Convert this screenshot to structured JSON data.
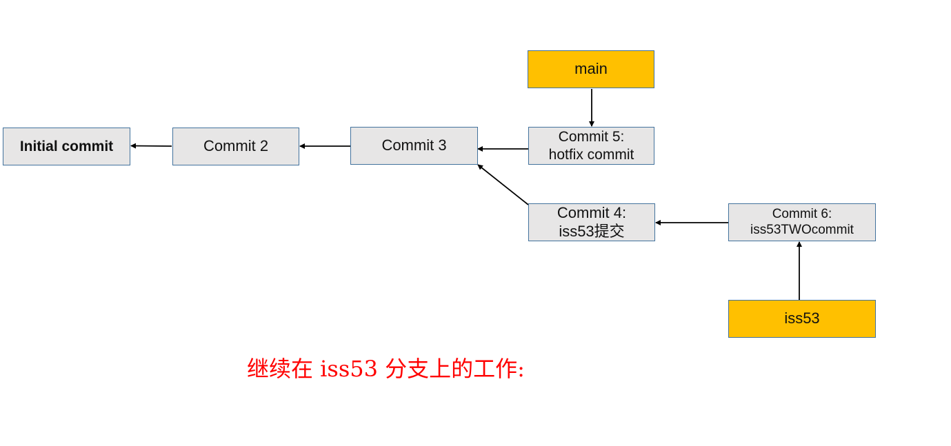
{
  "nodes": {
    "initial": {
      "label": "Initial commit"
    },
    "c2": {
      "label": "Commit 2"
    },
    "c3": {
      "label": "Commit 3"
    },
    "c5": {
      "line1": "Commit 5:",
      "line2": "hotfix commit"
    },
    "c4": {
      "line1": "Commit 4:",
      "line2": "iss53提交"
    },
    "c6": {
      "line1": "Commit 6:",
      "line2": "iss53TWOcommit"
    }
  },
  "branches": {
    "main": {
      "label": "main",
      "color": "#ffc000"
    },
    "iss53": {
      "label": "iss53",
      "color": "#ffc000"
    }
  },
  "edges": [
    {
      "from": "c2",
      "to": "initial"
    },
    {
      "from": "c3",
      "to": "c2"
    },
    {
      "from": "c5",
      "to": "c3"
    },
    {
      "from": "c4",
      "to": "c3"
    },
    {
      "from": "c6",
      "to": "c4"
    },
    {
      "from": "main",
      "to": "c5"
    },
    {
      "from": "iss53",
      "to": "c6"
    }
  ],
  "caption": "继续在 iss53 分支上的工作:"
}
